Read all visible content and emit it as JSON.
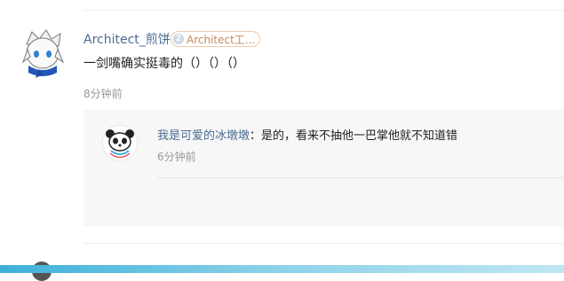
{
  "comment": {
    "username": "Architect_煎饼",
    "badge_level": "2",
    "badge_text": "Architect工...",
    "text": "一剑嘴确实挺毒的（）（）（）",
    "time": "8分钟前"
  },
  "reply": {
    "username": "我是可爱的冰墩墩",
    "separator": "：",
    "text": "是的，看来不抽他一巴掌他就不知道错",
    "time": "6分钟前"
  },
  "colors": {
    "username": "#4a6b92",
    "time": "#999999",
    "badge_border": "#f0c8a8",
    "reply_bg": "#f7f7f7",
    "bottom_bar": "#3db0d8"
  }
}
